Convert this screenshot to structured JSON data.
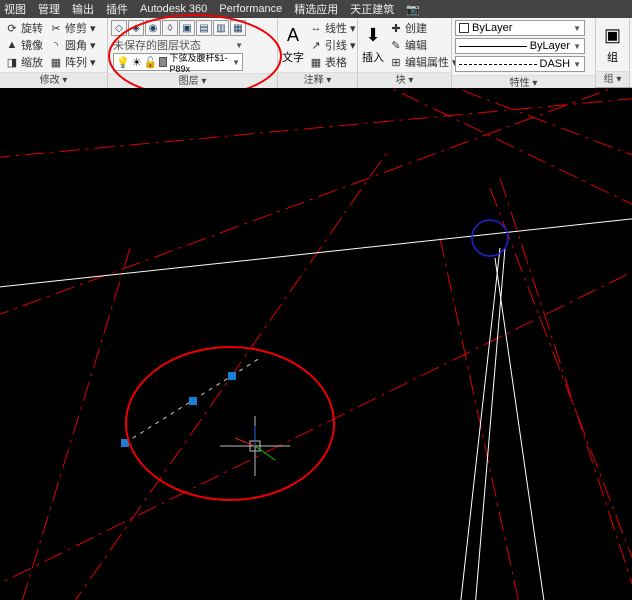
{
  "menu": {
    "items": [
      "视图",
      "管理",
      "输出",
      "插件",
      "Autodesk 360",
      "Performance",
      "精选应用",
      "天正建筑",
      "📷"
    ]
  },
  "ribbon": {
    "modify": {
      "title": "修改 ▾",
      "rows": [
        [
          "旋转",
          "修剪 ▾",
          ""
        ],
        [
          "镜像",
          "圆角 ▾",
          ""
        ],
        [
          "缩放",
          "阵列 ▾",
          ""
        ]
      ]
    },
    "layer": {
      "title": "图层 ▾",
      "state": "未保存的图层状态",
      "current": "下弦及腹杆$1-P89x"
    },
    "annot": {
      "title": "注释 ▾",
      "text": "文字",
      "items": [
        "线性 ▾",
        "引线 ▾",
        "表格"
      ]
    },
    "block": {
      "title": "块 ▾",
      "insert": "插入",
      "items": [
        "创建",
        "编辑",
        "编辑属性 ▾"
      ]
    },
    "props": {
      "title": "特性 ▾",
      "color": "ByLayer",
      "ltype": "ByLayer",
      "lweight": "DASH"
    },
    "group": {
      "title": "组 ▾",
      "label": "组"
    }
  }
}
